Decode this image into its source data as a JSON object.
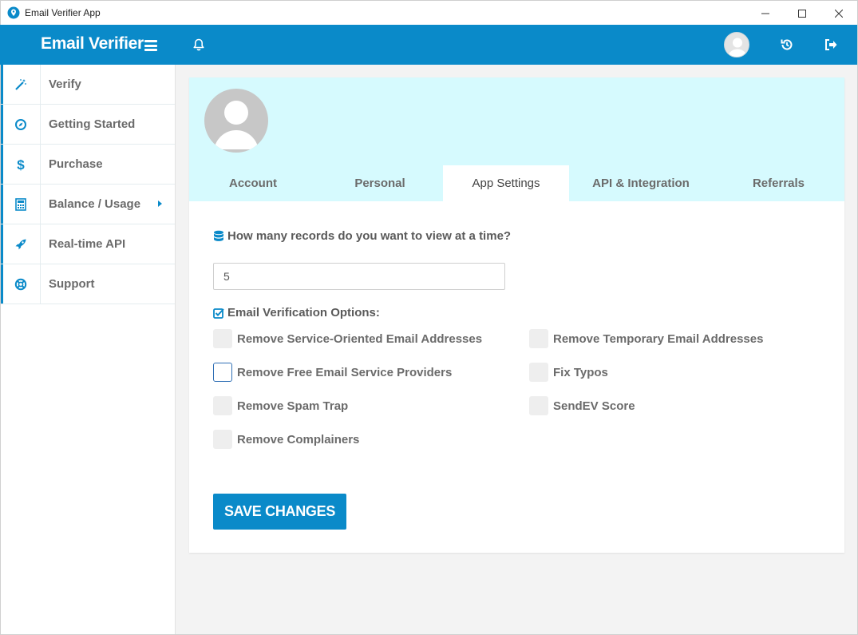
{
  "window": {
    "title": "Email Verifier App",
    "controls": [
      "minimize",
      "maximize",
      "close"
    ]
  },
  "header": {
    "brand": "Email Verifier",
    "icons": [
      "hamburger-icon",
      "bell-icon",
      "avatar",
      "history-icon",
      "logout-icon"
    ]
  },
  "colors": {
    "primary": "#0a8ac9",
    "header_bg": "#d6fafe",
    "page_bg": "#f3f3f3"
  },
  "sidebar": {
    "items": [
      {
        "label": "Verify",
        "icon": "magic-wand-icon"
      },
      {
        "label": "Getting Started",
        "icon": "compass-icon"
      },
      {
        "label": "Purchase",
        "icon": "dollar-icon"
      },
      {
        "label": "Balance / Usage",
        "icon": "calculator-icon",
        "has_submenu": true
      },
      {
        "label": "Real-time API",
        "icon": "rocket-icon"
      },
      {
        "label": "Support",
        "icon": "lifebuoy-icon"
      }
    ]
  },
  "tabs": [
    {
      "label": "Account",
      "active": false
    },
    {
      "label": "Personal",
      "active": false
    },
    {
      "label": "App Settings",
      "active": true
    },
    {
      "label": "API & Integration",
      "active": false
    },
    {
      "label": "Referrals",
      "active": false
    }
  ],
  "settings": {
    "records_question": "How many records do you want to view at a time?",
    "records_value": "5",
    "options_title": "Email Verification Options:",
    "options": [
      {
        "label": "Remove Service-Oriented Email Addresses",
        "checked": false
      },
      {
        "label": "Remove Temporary Email Addresses",
        "checked": false
      },
      {
        "label": "Remove Free Email Service Providers",
        "checked": false,
        "focused": true
      },
      {
        "label": "Fix Typos",
        "checked": false
      },
      {
        "label": "Remove Spam Trap",
        "checked": false
      },
      {
        "label": "SendEV Score",
        "checked": false
      },
      {
        "label": "Remove Complainers",
        "checked": false
      }
    ],
    "save_label": "SAVE CHANGES"
  }
}
